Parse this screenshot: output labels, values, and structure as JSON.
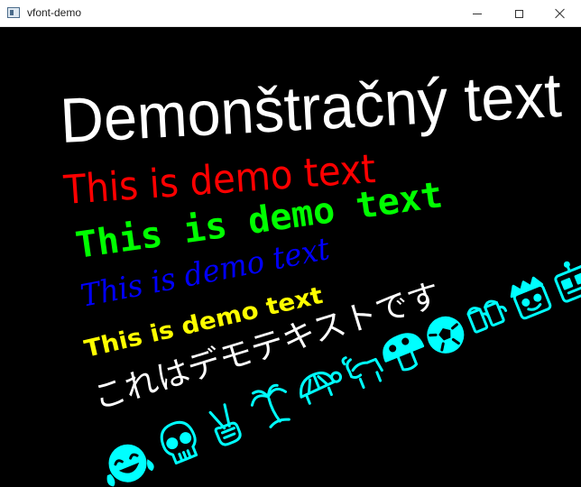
{
  "window": {
    "title": "vfont-demo"
  },
  "demo_lines": [
    {
      "text": "Demonštračný text",
      "color": "#ffffff"
    },
    {
      "text": "This is demo text",
      "color": "#ff0000"
    },
    {
      "text": "This is demo text",
      "color": "#00ff00"
    },
    {
      "text": "This is demo text",
      "color": "#0000ff"
    },
    {
      "text": "This is demo text",
      "color": "#ffff00"
    },
    {
      "text": "これはデモテキストです",
      "color": "#ffffff"
    }
  ],
  "emoji_row": {
    "color": "#00ffff",
    "icons": [
      "tears-of-joy-face-icon",
      "skull-icon",
      "victory-hand-icon",
      "palm-tree-icon",
      "turtle-icon",
      "goat-icon",
      "mushroom-icon",
      "soccer-ball-icon",
      "beer-mugs-icon",
      "crowned-face-icon",
      "robot-face-icon"
    ]
  }
}
